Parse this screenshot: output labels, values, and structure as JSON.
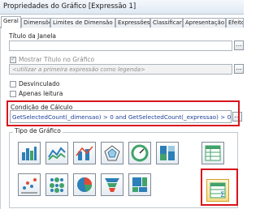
{
  "window": {
    "title": "Propriedades do Gráfico [Expressão 1]"
  },
  "tabs": [
    {
      "label": "Geral",
      "active": true
    },
    {
      "label": "Dimensões"
    },
    {
      "label": "Limites de Dimensão"
    },
    {
      "label": "Expressões"
    },
    {
      "label": "Classificar"
    },
    {
      "label": "Apresentação"
    },
    {
      "label": "Efeito"
    }
  ],
  "general": {
    "window_title_label": "Título da Janela",
    "window_title_value": "",
    "show_title_label": "Mostrar Título no Gráfico",
    "show_title_checked": true,
    "title_placeholder": "<utilizar a primeira expressão como legenda>",
    "detached_label": "Desvinculado",
    "readonly_label": "Apenas leitura"
  },
  "calc_condition": {
    "label": "Condição de Cálculo",
    "expression": "GetSelectedCount(_dimensao) > 0 and GetSelectedCount(_expressao) > 0"
  },
  "chart_type": {
    "label": "Tipo de Gráfico",
    "icons": [
      "bar-chart-icon",
      "line-chart-icon",
      "combo-chart-icon",
      "radar-chart-icon",
      "gauge-chart-icon",
      "mekko-chart-icon",
      "scatter-chart-icon",
      "grid-chart-icon",
      "pie-chart-icon",
      "funnel-chart-icon",
      "block-chart-icon",
      "straight-table-icon"
    ],
    "selected": "straight-table-icon"
  },
  "ellipsis": "..."
}
